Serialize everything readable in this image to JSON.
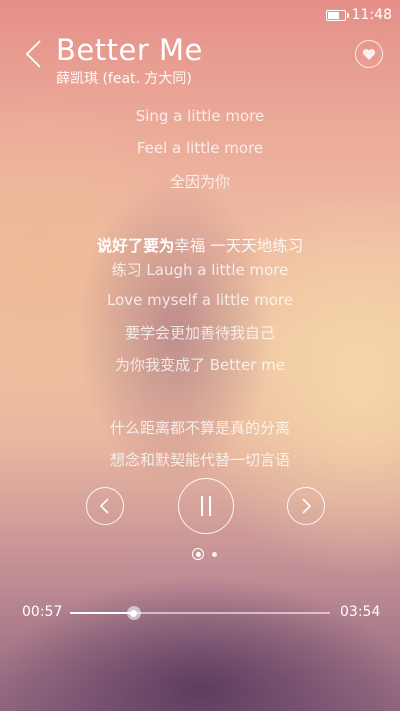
{
  "status_bar": {
    "time": "11:48",
    "battery_level": 0.8
  },
  "song": {
    "title": "Better Me",
    "artist": "薛凯琪 (feat. 方大同)"
  },
  "lyrics": {
    "before": [
      "Sing a little more",
      "Feel a little more",
      "全因为你"
    ],
    "current_sung": "说好了要为",
    "current_rest": "幸福 一天天地练习",
    "after": [
      "练习 Laugh a little more",
      "Love myself a little more",
      "要学会更加善待我自己",
      "为你我变成了 Better me",
      "",
      "什么距离都不算是真的分离",
      "想念和默契能代替一切言语"
    ]
  },
  "controls": {
    "prev_icon": "chevron-left-icon",
    "pause_icon": "pause-icon",
    "next_icon": "chevron-right-icon"
  },
  "pager": {
    "pages": 2,
    "current": 1
  },
  "progress": {
    "elapsed": "00:57",
    "total": "03:54",
    "fraction": 0.245
  },
  "colors": {
    "accent": "#ffffff"
  }
}
